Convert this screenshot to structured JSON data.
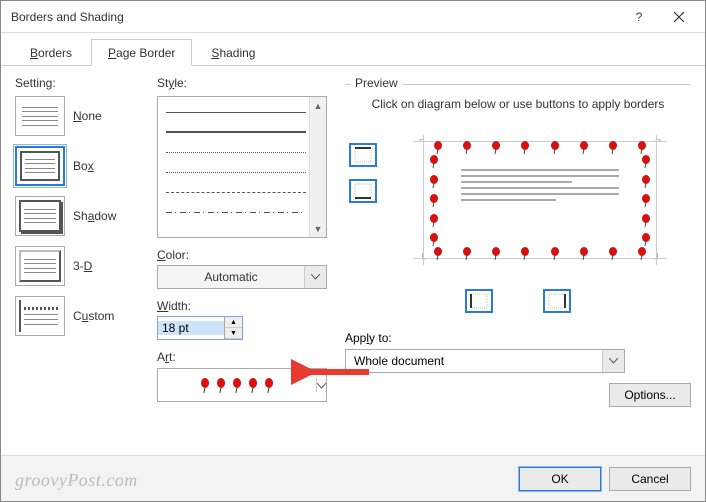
{
  "window": {
    "title": "Borders and Shading"
  },
  "tabs": {
    "borders": "Borders",
    "page_border": "Page Border",
    "shading": "Shading",
    "active": "page_border"
  },
  "setting": {
    "label": "Setting:",
    "options": {
      "none": "None",
      "box": "Box",
      "shadow": "Shadow",
      "threed": "3-D",
      "custom": "Custom"
    },
    "selected": "box"
  },
  "style": {
    "label": "Style:",
    "color_label": "Color:",
    "color_value": "Automatic",
    "width_label": "Width:",
    "width_value": "18 pt",
    "art_label": "Art:"
  },
  "preview": {
    "legend": "Preview",
    "hint": "Click on diagram below or use buttons to apply borders",
    "apply_label": "Apply to:",
    "apply_value": "Whole document",
    "options_btn": "Options..."
  },
  "footer": {
    "ok": "OK",
    "cancel": "Cancel"
  },
  "watermark": "groovyPost.com"
}
